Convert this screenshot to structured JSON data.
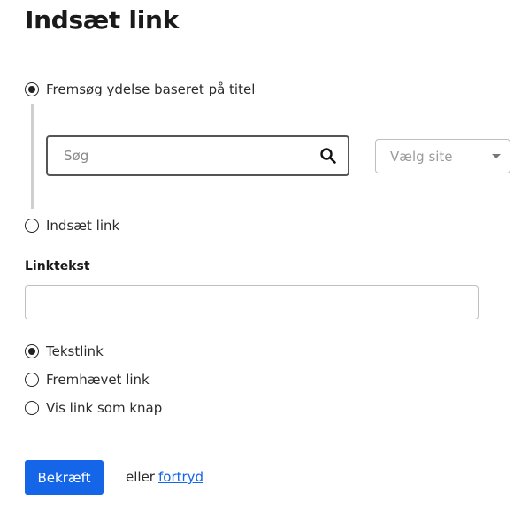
{
  "page": {
    "title": "Indsæt link"
  },
  "link_source": {
    "option_search_label": "Fremsøg ydelse baseret på titel",
    "option_insert_label": "Indsæt link",
    "search": {
      "placeholder": "Søg",
      "value": ""
    },
    "site_select": {
      "placeholder": "Vælg site"
    }
  },
  "link_text": {
    "label": "Linktekst",
    "value": ""
  },
  "link_style": {
    "options": [
      "Tekstlink",
      "Fremhævet link",
      "Vis link som knap"
    ],
    "selected": "Tekstlink"
  },
  "actions": {
    "confirm_label": "Bekræft",
    "or_text": "eller",
    "cancel_label": "fortryd"
  },
  "colors": {
    "primary": "#1565e8",
    "text": "#1a1a1a",
    "rail": "#cfcfcf"
  }
}
